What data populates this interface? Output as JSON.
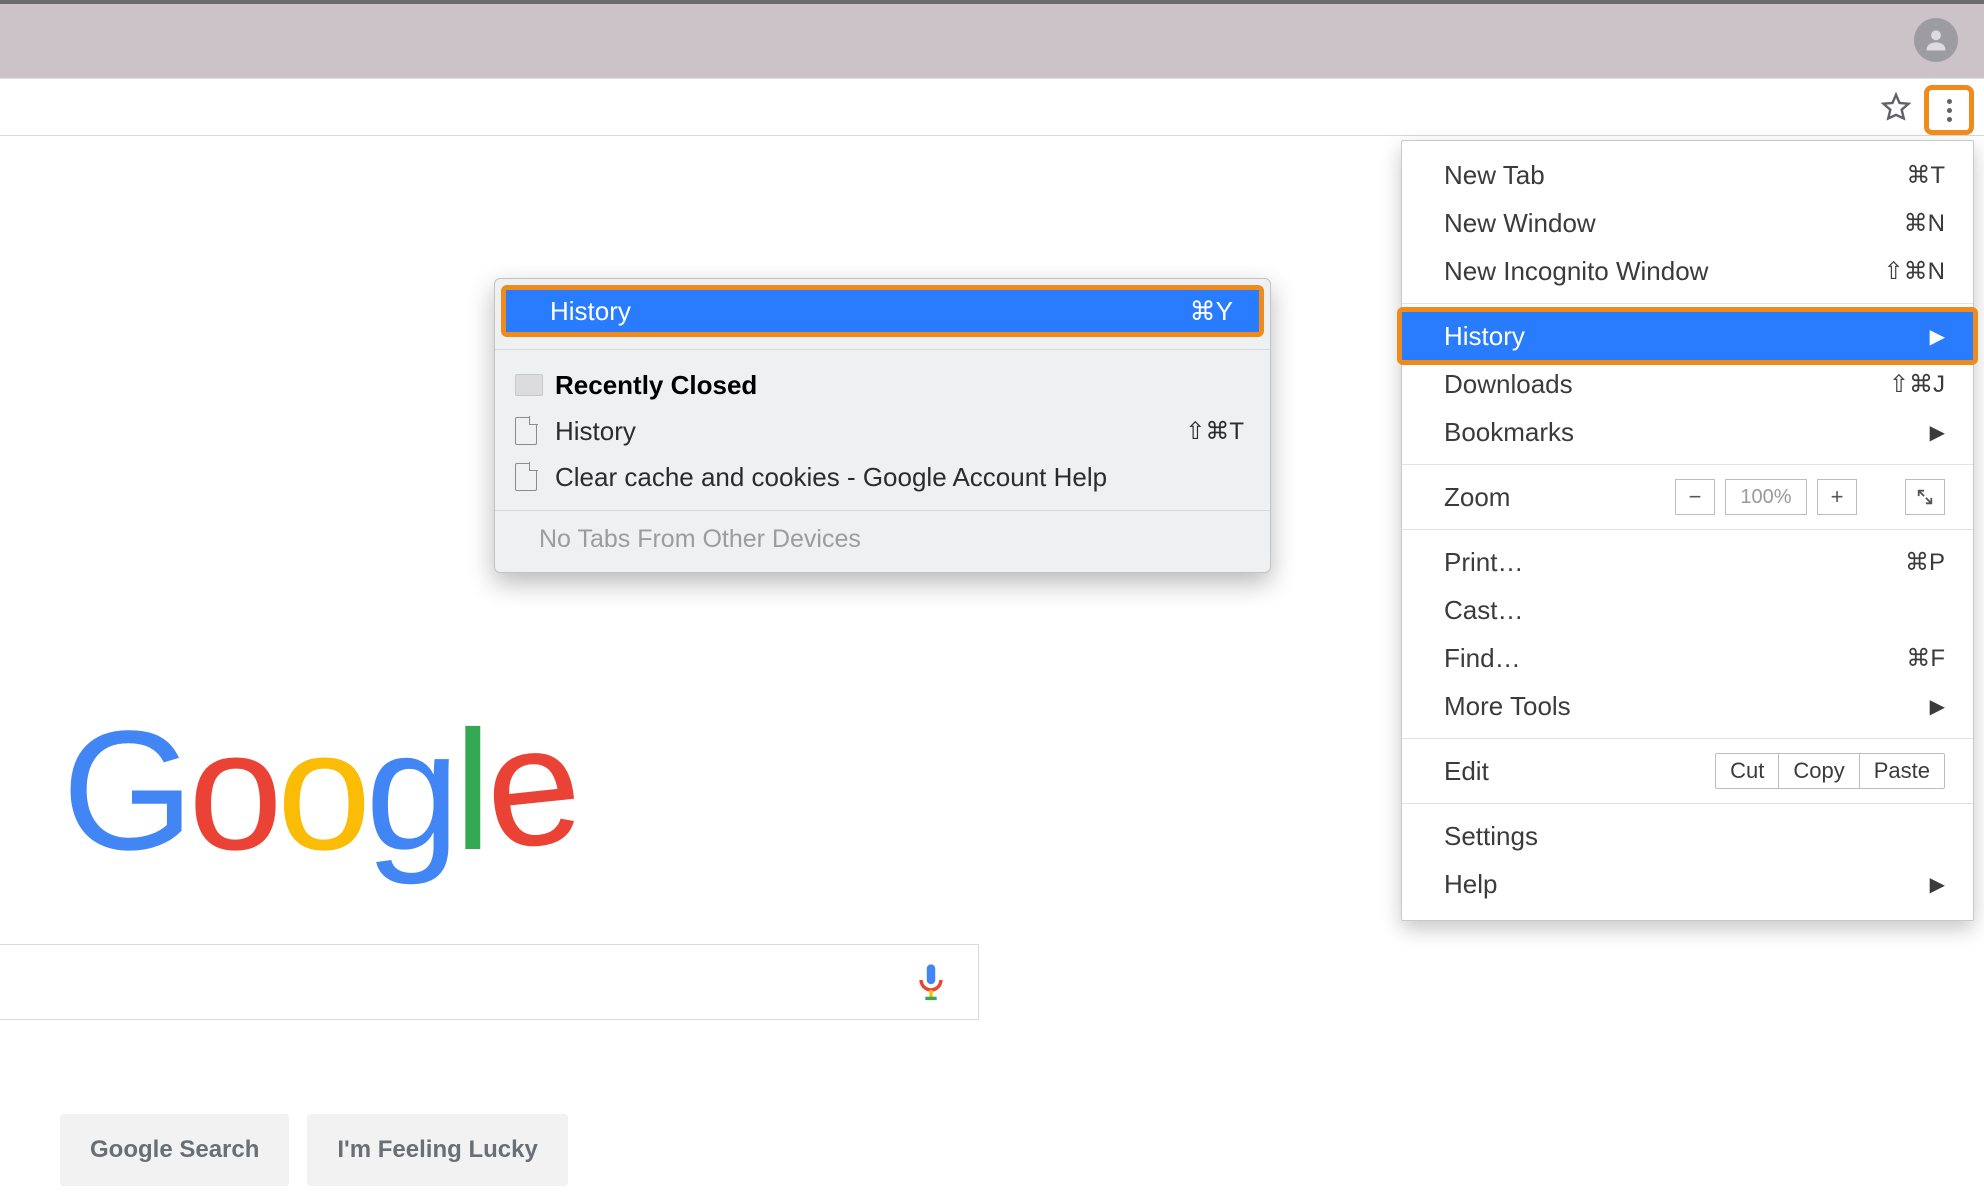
{
  "toolbar": {
    "profile_alt": "profile"
  },
  "menu": {
    "new_tab": "New Tab",
    "new_tab_sc": "⌘T",
    "new_window": "New Window",
    "new_window_sc": "⌘N",
    "new_incognito": "New Incognito Window",
    "new_incognito_sc": "⇧⌘N",
    "history": "History",
    "downloads": "Downloads",
    "downloads_sc": "⇧⌘J",
    "bookmarks": "Bookmarks",
    "zoom": "Zoom",
    "zoom_value": "100%",
    "print": "Print…",
    "print_sc": "⌘P",
    "cast": "Cast…",
    "find": "Find…",
    "find_sc": "⌘F",
    "more_tools": "More Tools",
    "edit": "Edit",
    "cut": "Cut",
    "copy": "Copy",
    "paste": "Paste",
    "settings": "Settings",
    "help": "Help"
  },
  "submenu": {
    "history": "History",
    "history_sc": "⌘Y",
    "recently_closed": "Recently Closed",
    "item1": "History",
    "item1_sc": "⇧⌘T",
    "item2": "Clear cache and cookies - Google Account Help",
    "footer": "No Tabs From Other Devices"
  },
  "page": {
    "logo_g1": "G",
    "logo_o1": "o",
    "logo_o2": "o",
    "logo_g2": "g",
    "logo_l": "l",
    "logo_e": "e",
    "btn_search": "Google Search",
    "btn_lucky": "I'm Feeling Lucky"
  }
}
